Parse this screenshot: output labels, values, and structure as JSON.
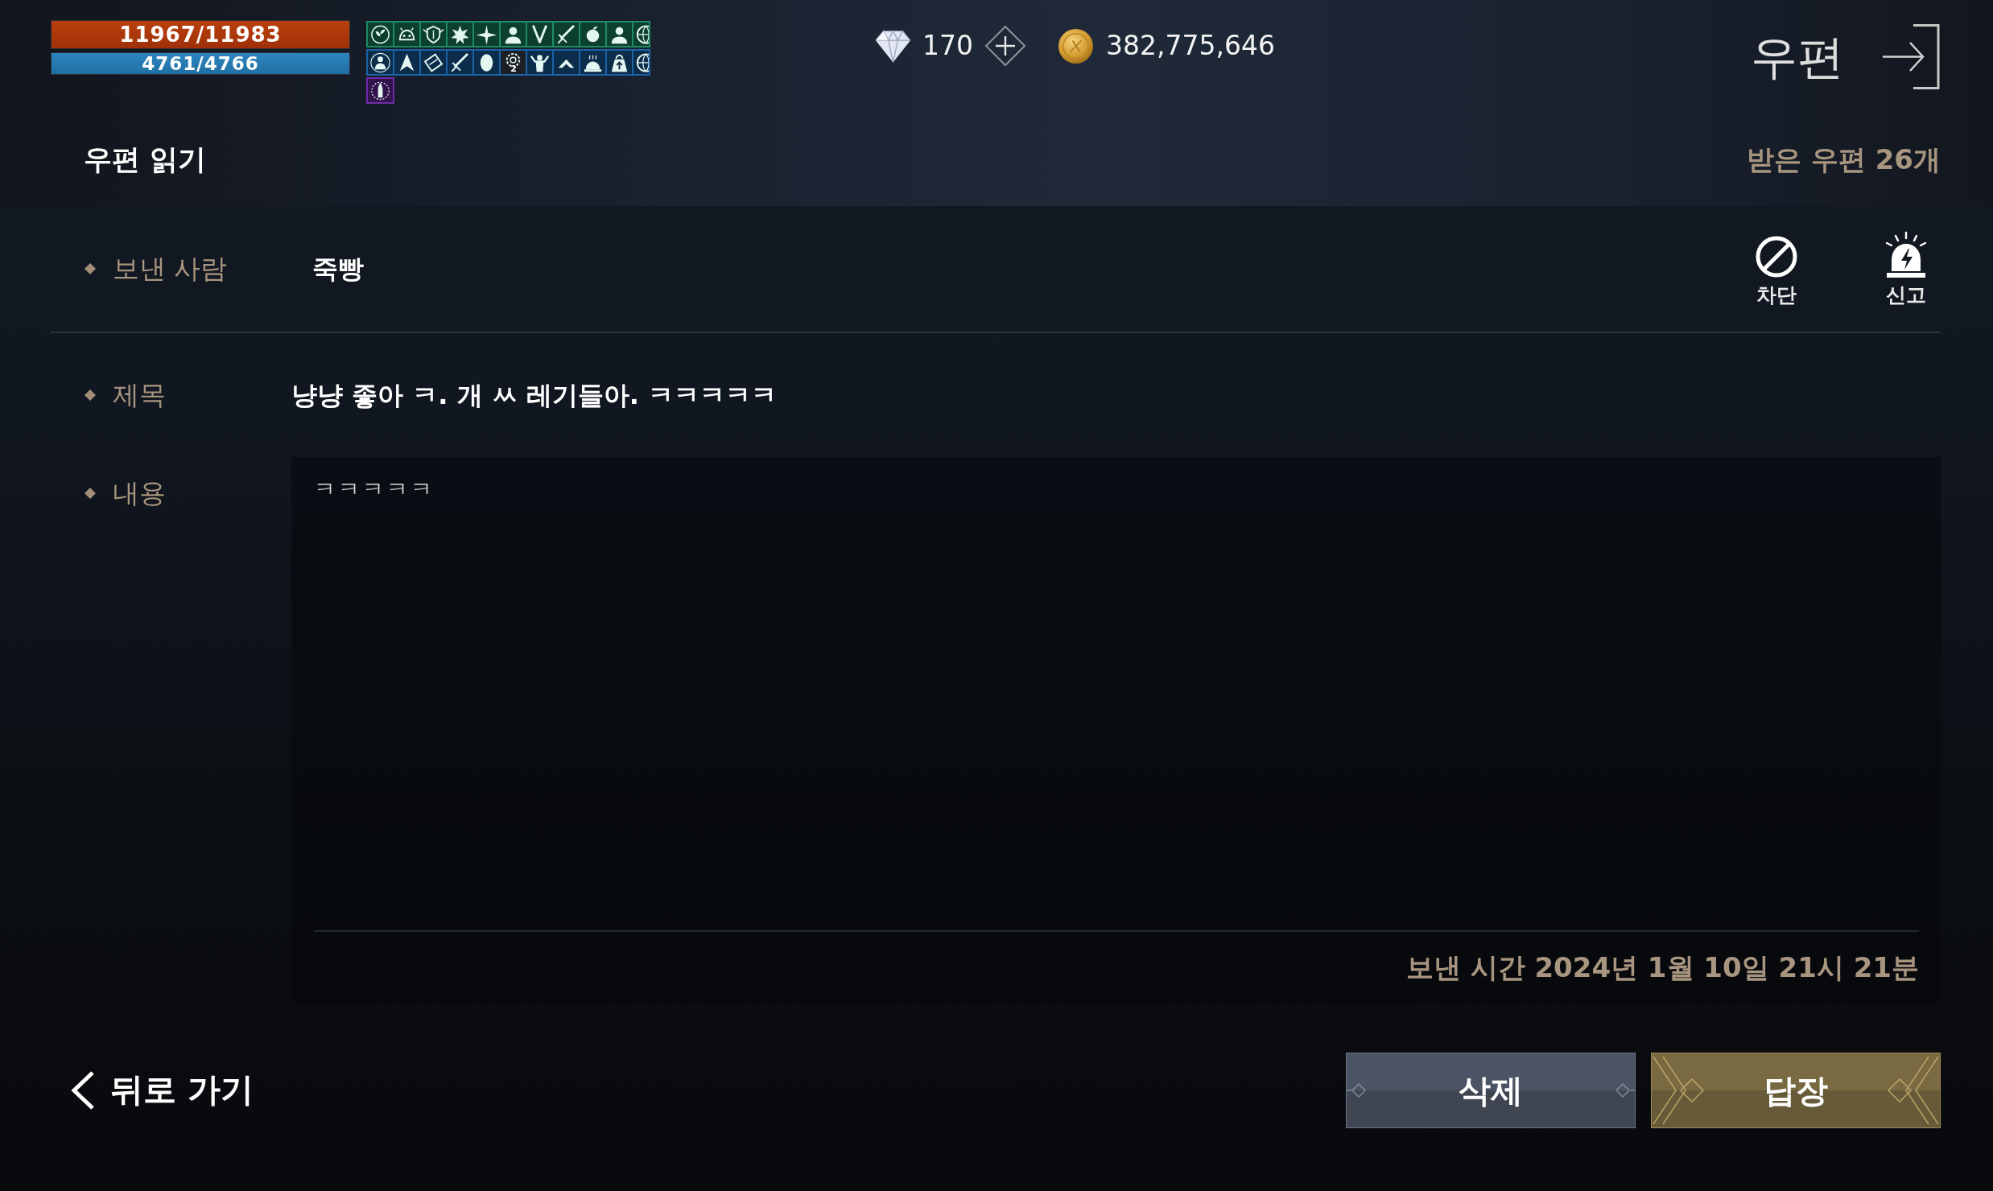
{
  "status": {
    "hp": {
      "reading": "11967/11983",
      "level": 0.999
    },
    "mp": {
      "reading": "4761/4766",
      "level": 0.999
    }
  },
  "buffs": [
    {
      "color": "#1d8c66",
      "items": [
        {
          "kind": "sprout"
        },
        {
          "kind": "pot"
        },
        {
          "kind": "crest"
        },
        {
          "kind": "burst"
        },
        {
          "kind": "spark"
        },
        {
          "kind": "bust"
        },
        {
          "kind": "blades"
        },
        {
          "kind": "sword"
        },
        {
          "kind": "orb"
        },
        {
          "kind": "bust"
        },
        {
          "kind": "globe"
        }
      ]
    },
    {
      "color": "#1c63a6",
      "items": [
        {
          "kind": "figure"
        },
        {
          "kind": "arrow"
        },
        {
          "kind": "scroll"
        },
        {
          "kind": "sword"
        },
        {
          "kind": "oval"
        },
        {
          "kind": "gear",
          "count": "2"
        },
        {
          "kind": "muscle"
        },
        {
          "kind": "chevron"
        },
        {
          "kind": "bell"
        },
        {
          "kind": "weight"
        },
        {
          "kind": "globe"
        }
      ]
    },
    {
      "color": "#6f2ca8",
      "items": [
        {
          "kind": "candle"
        }
      ]
    }
  ],
  "currencies": [
    {
      "kind": "gem",
      "amount": "170"
    },
    {
      "kind": "gold",
      "amount": "382,775,646"
    }
  ],
  "screen_title": "우편",
  "header": {
    "title": "우편 읽기",
    "mail_count": "받은 우편 26개"
  },
  "sender": {
    "label": "보낸 사람",
    "value": "죽빵",
    "actions": [
      {
        "kind": "block",
        "label": "차단"
      },
      {
        "kind": "report",
        "label": "신고"
      }
    ]
  },
  "subject": {
    "label": "제목",
    "value": "냥냥 좋아 ㅋ. 개 ㅆ 레기들아. ㅋㅋㅋㅋㅋ"
  },
  "content": {
    "label": "내용",
    "body": "ㅋㅋㅋㅋㅋ",
    "sent_time": "보낸 시간 2024년 1월 10일 21시 21분"
  },
  "back": {
    "label": "뒤로 가기"
  },
  "buttons": [
    {
      "kind": "delete",
      "label": "삭제"
    },
    {
      "kind": "reply",
      "label": "답장"
    }
  ]
}
